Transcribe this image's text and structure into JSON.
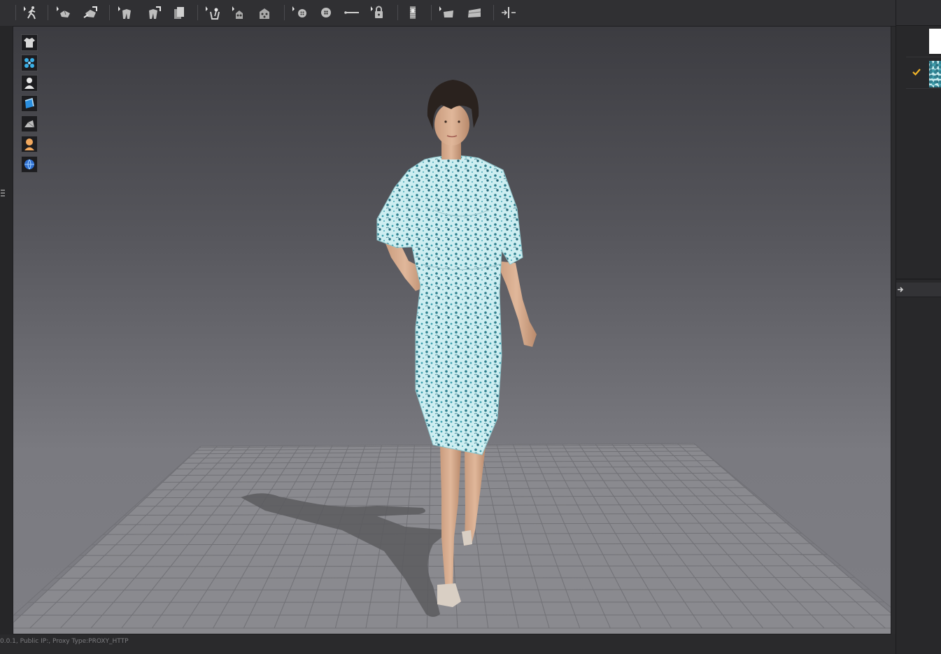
{
  "toolbar": {
    "tools": [
      {
        "icon": "avatar-walk-icon"
      },
      {
        "icon": "select-pattern-icon"
      },
      {
        "icon": "transform-pattern-icon"
      },
      {
        "icon": "select-mesh-icon"
      },
      {
        "icon": "move-mesh-icon"
      },
      {
        "icon": "fold-arrangement-icon"
      },
      {
        "icon": "pin-icon"
      },
      {
        "icon": "tack-icon"
      },
      {
        "icon": "group-tack-icon"
      },
      {
        "icon": "select-button-icon"
      },
      {
        "icon": "button-icon"
      },
      {
        "icon": "topstitch-line-icon"
      },
      {
        "icon": "buttonhole-lock-icon"
      },
      {
        "icon": "zipper-icon"
      },
      {
        "icon": "select-trim-icon"
      },
      {
        "icon": "trim-icon"
      },
      {
        "icon": "measure-icon"
      }
    ]
  },
  "viewport_tools": [
    {
      "icon": "garment-display-icon"
    },
    {
      "icon": "particle-display-icon"
    },
    {
      "icon": "avatar-display-icon"
    },
    {
      "icon": "fabric-render-icon"
    },
    {
      "icon": "shading-icon"
    },
    {
      "icon": "avatar-skin-icon"
    },
    {
      "icon": "environment-globe-icon"
    }
  ],
  "material_list": {
    "items": [
      {
        "swatch": "white",
        "checked": false
      },
      {
        "swatch": "floral-print",
        "checked": true
      }
    ],
    "check_color": "#f0b429"
  },
  "status_bar": {
    "text": "0.0.1, Public IP:, Proxy Type:PROXY_HTTP"
  },
  "colors": {
    "accent": "#f0b429",
    "viewport_top": "#3c3c41",
    "viewport_bottom": "#7e7e84",
    "dress_base": "#c8ecef",
    "dress_print": "#2f7f8f"
  }
}
